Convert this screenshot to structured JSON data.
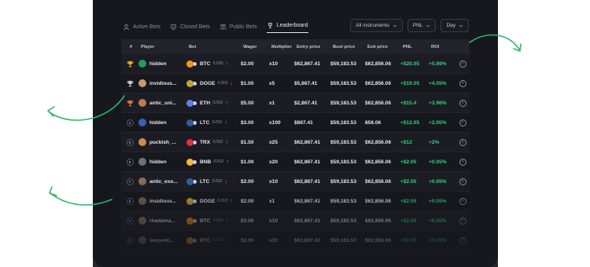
{
  "tabs": [
    {
      "label": "Active Bets",
      "icon": "user-icon"
    },
    {
      "label": "Closed Bets",
      "icon": "shield-icon"
    },
    {
      "label": "Public Bets",
      "icon": "users-icon"
    },
    {
      "label": "Leaderboard",
      "icon": "trophy-icon",
      "active": true
    }
  ],
  "filters": {
    "instruments": "All instruments",
    "metric": "PNL",
    "period": "Day"
  },
  "columns": [
    "#",
    "Player",
    "Bet",
    "Wager",
    "Multiplier",
    "Entry price",
    "Bust price",
    "Exit price",
    "PNL",
    "ROI"
  ],
  "rows": [
    {
      "rank": "1",
      "rank_style": "gold-trophy",
      "player": "hidden",
      "coin": "BTC",
      "coin_color": "#f7931a",
      "dir": "up",
      "wager": "$2.00",
      "mult": "x10",
      "entry": "$62,867.41",
      "bust": "$59,183.53",
      "exit": "$62,856.06",
      "pnl": "+$20.05",
      "roi": "+5.99%"
    },
    {
      "rank": "2",
      "rank_style": "silver-trophy",
      "player": "invidious...",
      "coin": "DOGE",
      "coin_color": "#c2a633",
      "dir": "down",
      "wager": "$1.00",
      "mult": "x5",
      "entry": "$5,867.41",
      "bust": "$59,183.53",
      "exit": "$62,856.06",
      "pnl": "+$19.05",
      "roi": "+4.05%"
    },
    {
      "rank": "3",
      "rank_style": "bronze-trophy",
      "player": "antic_uni...",
      "coin": "ETH",
      "coin_color": "#627eea",
      "dir": "up",
      "wager": "$5.00",
      "mult": "x1",
      "entry": "$2,867.41",
      "bust": "$59,183.53",
      "exit": "$62,856.06",
      "pnl": "+$15.4",
      "roi": "+3.96%"
    },
    {
      "rank": "4",
      "rank_style": "circle",
      "player": "hidden",
      "coin": "LTC",
      "coin_color": "#345d9d",
      "dir": "up",
      "wager": "$3.00",
      "mult": "x100",
      "entry": "$867.41",
      "bust": "$59,183.53",
      "exit": "856.06",
      "pnl": "+$12.05",
      "roi": "+2.05%"
    },
    {
      "rank": "5",
      "rank_style": "circle",
      "player": "puckish_...",
      "coin": "TRX",
      "coin_color": "#e83035",
      "dir": "up",
      "wager": "$1.50",
      "mult": "x25",
      "entry": "$62,867.41",
      "bust": "$59,183.53",
      "exit": "$62,856.06",
      "pnl": "+$12",
      "roi": "+2%"
    },
    {
      "rank": "6",
      "rank_style": "circle",
      "player": "hidden",
      "coin": "BNB",
      "coin_color": "#f3ba2f",
      "dir": "up",
      "wager": "$1.00",
      "mult": "x20",
      "entry": "$62,867.41",
      "bust": "$59,183.53",
      "exit": "$62,856.06",
      "pnl": "+$2.05",
      "roi": "+0.05%"
    },
    {
      "rank": "7",
      "rank_style": "circle",
      "player": "antic_exo...",
      "coin": "LTC",
      "coin_color": "#345d9d",
      "dir": "down",
      "wager": "$2.00",
      "mult": "x10",
      "entry": "$62,867.41",
      "bust": "$59,183.53",
      "exit": "$62,856.06",
      "pnl": "+$2.05",
      "roi": "+0.05%"
    },
    {
      "rank": "8",
      "rank_style": "circle",
      "player": "insidious...",
      "coin": "DOGE",
      "coin_color": "#c2a633",
      "dir": "up",
      "wager": "$2.00",
      "mult": "x1",
      "entry": "$62,867.41",
      "bust": "$59,183.53",
      "exit": "$62,856.06",
      "pnl": "+$2.05",
      "roi": "+0.05%"
    },
    {
      "rank": "9",
      "rank_style": "circle",
      "player": "rhadama...",
      "coin": "BTC",
      "coin_color": "#f7931a",
      "dir": "up",
      "wager": "$3.00",
      "mult": "x10",
      "entry": "$62,867.41",
      "bust": "$59,183.53",
      "exit": "$62,856.06",
      "pnl": "+$2.05",
      "roi": "+0.05%"
    },
    {
      "rank": "10",
      "rank_style": "circle",
      "player": "serpenti...",
      "coin": "BTC",
      "coin_color": "#f7931a",
      "dir": "up",
      "wager": "$2.00",
      "mult": "x10",
      "entry": "$62,867.41",
      "bust": "$59,183.53",
      "exit": "$62,856.06",
      "pnl": "+$2.05",
      "roi": "+0.05%"
    }
  ],
  "currency": "/USD",
  "info_glyph": "i",
  "colors": {
    "accent_green": "#32d17b",
    "down_red": "#f05252",
    "panel": "#17181e",
    "arrow_green": "#2fb866"
  }
}
